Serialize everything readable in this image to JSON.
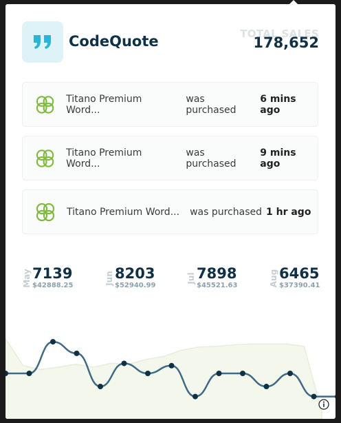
{
  "brand": {
    "name": "CodeQuote",
    "icon": "quote-icon",
    "accent": "#27b6d8"
  },
  "total_sales": {
    "label": "TOTAL SALES",
    "value": "178,652"
  },
  "purchases": [
    {
      "product": "Titano Premium Word...",
      "action": "was purchased",
      "time": "6 mins ago",
      "icon": "product-thumbnail-icon"
    },
    {
      "product": "Titano Premium Word...",
      "action": "was purchased",
      "time": "9 mins ago",
      "icon": "product-thumbnail-icon"
    },
    {
      "product": "Titano Premium Word...",
      "action": "was purchased",
      "time": "1 hr ago",
      "icon": "product-thumbnail-icon"
    }
  ],
  "months": [
    {
      "name": "May",
      "units": "7139",
      "revenue": "$42888.25"
    },
    {
      "name": "Jun",
      "units": "8203",
      "revenue": "$52940.99"
    },
    {
      "name": "Jul",
      "units": "7898",
      "revenue": "$45521.63"
    },
    {
      "name": "Aug",
      "units": "6465",
      "revenue": "$37390.41"
    }
  ],
  "chart_data": {
    "type": "line",
    "series": [
      {
        "values": [
          0.5,
          0.5,
          0.91,
          0.76,
          0.33,
          0.63,
          0.5,
          0.6,
          0.2,
          0.5,
          0.5,
          0.33,
          0.5,
          0.2,
          0.2,
          0.2
        ],
        "color": "#3d6a87"
      }
    ],
    "area": {
      "values": [
        0.95,
        0.6,
        0.55,
        0.58,
        0.62,
        0.58,
        0.63,
        0.62,
        0.68,
        0.72,
        0.8,
        0.84,
        0.85,
        0.87,
        0.88,
        0.88,
        0.88,
        0.85,
        0.0
      ],
      "color": "#f4f8ec"
    }
  },
  "info_icon": "info-icon"
}
